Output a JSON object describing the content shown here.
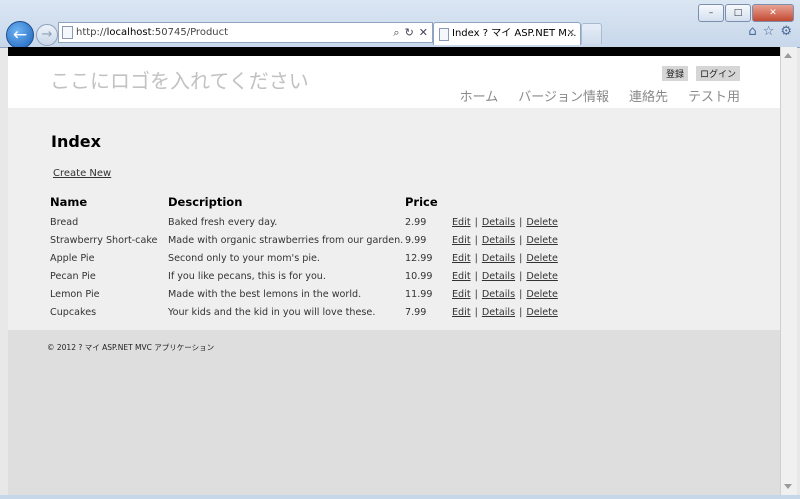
{
  "browser": {
    "url_prefix": "http://",
    "url_host": "localhost",
    "url_rest": ":50745/Product",
    "tab_title": "Index ? マイ ASP.NET M...",
    "tab_close": "✕",
    "search_icon": "⌕",
    "refresh_icon": "↻",
    "stop_icon": "✕",
    "back_icon": "←",
    "forward_icon": "→",
    "home_icon": "⌂",
    "favorites_icon": "☆",
    "tools_icon": "⚙",
    "minimize": "–",
    "maximize": "□",
    "close": "✕"
  },
  "header": {
    "logo": "ここにロゴを入れてください",
    "login": [
      "登録",
      "ログイン"
    ],
    "menu": [
      "ホーム",
      "バージョン情報",
      "連絡先",
      "テスト用"
    ]
  },
  "page": {
    "title": "Index",
    "create_link": "Create New",
    "columns": [
      "Name",
      "Description",
      "Price"
    ],
    "actions": [
      "Edit",
      "Details",
      "Delete"
    ],
    "separator": "|",
    "rows": [
      {
        "name": "Bread",
        "description": "Baked fresh every day.",
        "price": "2.99"
      },
      {
        "name": "Strawberry Short-cake",
        "description": "Made with organic strawberries from our garden.",
        "price": "9.99"
      },
      {
        "name": "Apple Pie",
        "description": "Second only to your mom's pie.",
        "price": "12.99"
      },
      {
        "name": "Pecan Pie",
        "description": "If you like pecans, this is for you.",
        "price": "10.99"
      },
      {
        "name": "Lemon Pie",
        "description": "Made with the best lemons in the world.",
        "price": "11.99"
      },
      {
        "name": "Cupcakes",
        "description": "Your kids and the kid in you will love these.",
        "price": "7.99"
      }
    ]
  },
  "footer": {
    "copyright": "© 2012 ? マイ ASP.NET MVC アプリケーション"
  }
}
